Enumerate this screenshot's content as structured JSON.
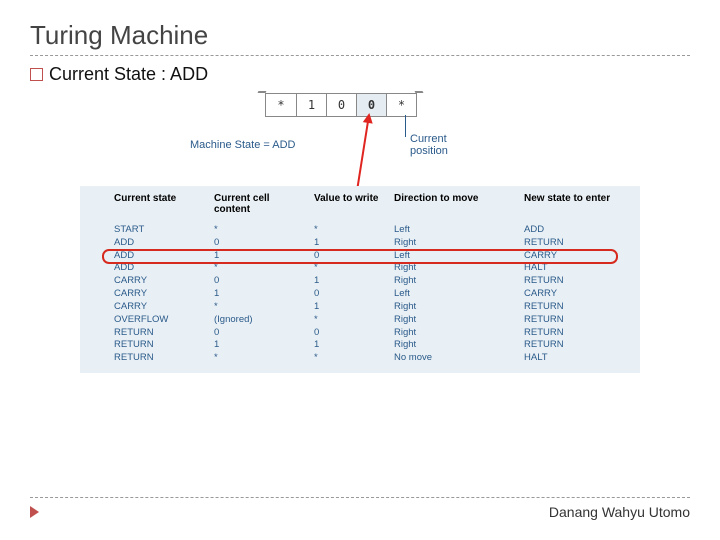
{
  "title": "Turing Machine",
  "bullet_text": "Current State : ADD",
  "figure": {
    "tape_cells": [
      "*",
      "1",
      "0",
      "0",
      "*"
    ],
    "active_index": 3,
    "machine_state_label": "Machine State = ADD",
    "current_position_label_1": "Current",
    "current_position_label_2": "position"
  },
  "table": {
    "headers": {
      "c0": "Current state",
      "c1": "Current cell content",
      "c2": "Value to write",
      "c3": "Direction to move",
      "c4": "New state to enter"
    },
    "rows": [
      {
        "c0": "START",
        "c1": "*",
        "c2": "*",
        "c3": "Left",
        "c4": "ADD"
      },
      {
        "c0": "ADD",
        "c1": "0",
        "c2": "1",
        "c3": "Right",
        "c4": "RETURN"
      },
      {
        "c0": "ADD",
        "c1": "1",
        "c2": "0",
        "c3": "Left",
        "c4": "CARRY"
      },
      {
        "c0": "ADD",
        "c1": "*",
        "c2": "*",
        "c3": "Right",
        "c4": "HALT"
      },
      {
        "c0": "CARRY",
        "c1": "0",
        "c2": "1",
        "c3": "Right",
        "c4": "RETURN"
      },
      {
        "c0": "CARRY",
        "c1": "1",
        "c2": "0",
        "c3": "Left",
        "c4": "CARRY"
      },
      {
        "c0": "CARRY",
        "c1": "*",
        "c2": "1",
        "c3": "Right",
        "c4": "RETURN"
      },
      {
        "c0": "OVERFLOW",
        "c1": "(Ignored)",
        "c2": "*",
        "c3": "Right",
        "c4": "RETURN"
      },
      {
        "c0": "RETURN",
        "c1": "0",
        "c2": "0",
        "c3": "Right",
        "c4": "RETURN"
      },
      {
        "c0": "RETURN",
        "c1": "1",
        "c2": "1",
        "c3": "Right",
        "c4": "RETURN"
      },
      {
        "c0": "RETURN",
        "c1": "*",
        "c2": "*",
        "c3": "No move",
        "c4": "HALT"
      }
    ],
    "highlight_row_index": 2
  },
  "author": "Danang Wahyu Utomo"
}
